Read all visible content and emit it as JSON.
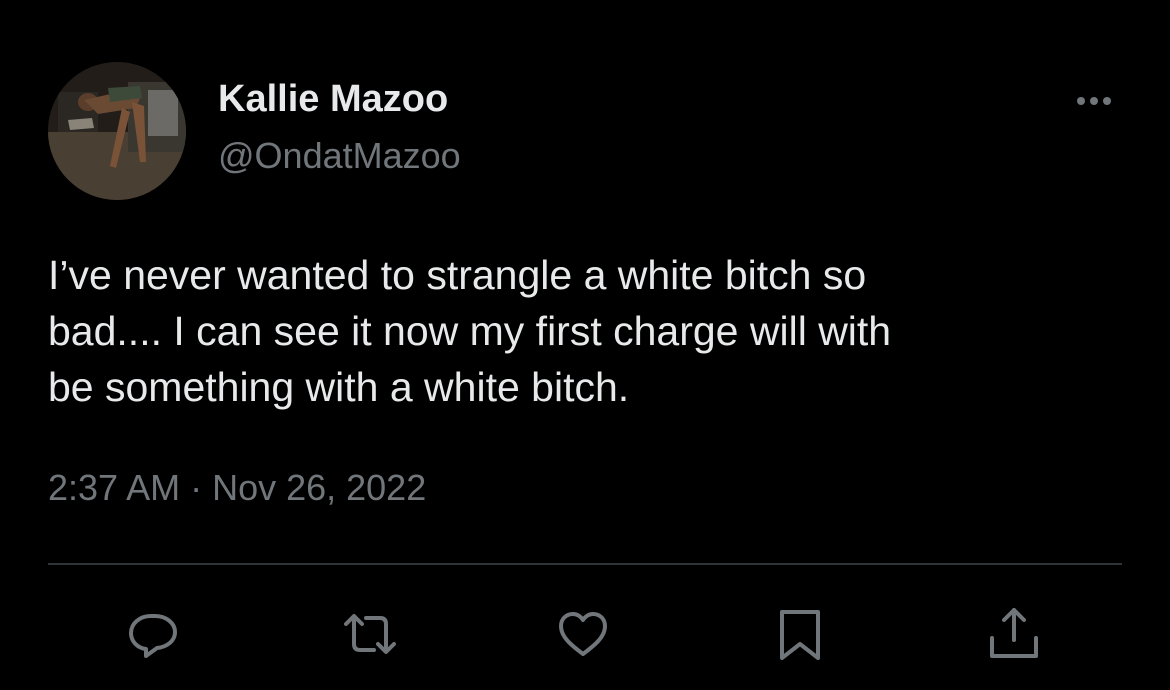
{
  "author": {
    "display_name": "Kallie Mazoo",
    "handle": "@OndatMazoo",
    "avatar_icon": "profile-photo"
  },
  "tweet": {
    "text_lines": [
      "I’ve never wanted to strangle a white bitch so",
      "bad.... I can see it now my first charge will with",
      "be something with a white bitch."
    ],
    "timestamp": "2:37 AM · Nov 26, 2022"
  },
  "actions": {
    "reply_icon": "reply-icon",
    "retweet_icon": "retweet-icon",
    "like_icon": "heart-icon",
    "bookmark_icon": "bookmark-icon",
    "share_icon": "share-icon",
    "more_icon": "more-options-icon"
  },
  "colors": {
    "background": "#000000",
    "primary_text": "#e7e9ea",
    "secondary_text": "#71767b",
    "divider": "#2f3336"
  }
}
